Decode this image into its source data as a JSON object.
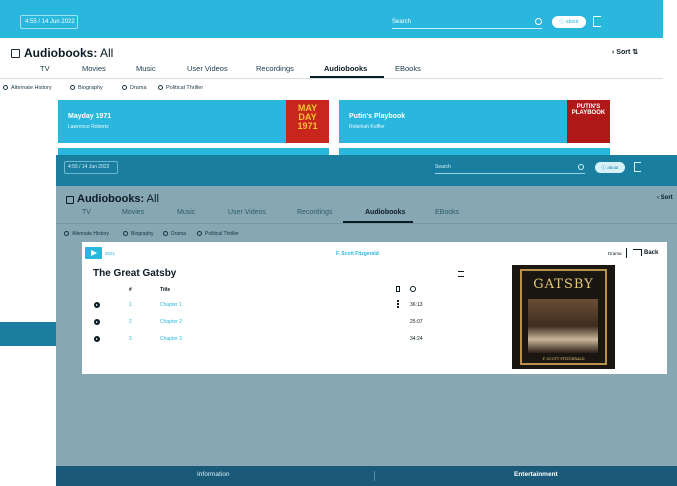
{
  "colors": {
    "accent": "#2ab7dd",
    "dark": "#0b1b24",
    "dim_bar": "#1a7ea0"
  },
  "background_screen": {
    "datetime": "4:55 / 14 Jun 2022",
    "search_label": "Search",
    "about_label": "ⓘ about",
    "title_prefix": "Audiobooks:",
    "title_suffix": "All",
    "sort_label": "‹  Sort ⇅",
    "tabs": [
      "TV",
      "Movies",
      "Music",
      "User Videos",
      "Recordings",
      "Audiobooks",
      "EBooks"
    ],
    "active_tab": "Audiobooks",
    "filters": [
      "Alternate History",
      "Biography",
      "Drama",
      "Political Thriller"
    ],
    "cards": [
      {
        "title": "Mayday 1971",
        "author": "Lawrence Roberts",
        "cover_text": "MAY DAY 1971",
        "cover_color": "#c8251d"
      },
      {
        "title": "Putin's Playbook",
        "author": "Rebekah Koffler",
        "cover_text": "PUTIN'S PLAYBOOK",
        "cover_color": "#b01818"
      }
    ]
  },
  "foreground_screen": {
    "datetime": "4:55 / 14 Jun 2022",
    "search_label": "Search",
    "about_label": "ⓘ about",
    "title_prefix": "Audiobooks:",
    "title_suffix": "All",
    "sort_label": "‹ Sort",
    "tabs": [
      "TV",
      "Movies",
      "Music",
      "User Videos",
      "Recordings",
      "Audiobooks",
      "EBooks"
    ],
    "active_tab": "Audiobooks",
    "filters": [
      "Alternate History",
      "Biography",
      "Drama",
      "Political Thriller"
    ],
    "detail": {
      "year": "2021",
      "author": "F. Scott Fitzgerald",
      "genre": "Drama",
      "back_label": "Back",
      "book_title": "The Great Gatsby",
      "columns": {
        "number": "#",
        "title": "Title"
      },
      "chapters": [
        {
          "n": "1",
          "title": "Chapter 1",
          "duration": "36:13"
        },
        {
          "n": "2",
          "title": "Chapter 2",
          "duration": "25:07"
        },
        {
          "n": "3",
          "title": "Chapter 3",
          "duration": "34:24"
        }
      ],
      "cover": {
        "title": "GATSBY",
        "subtitle": "F. SCOTT FITZGERALD"
      }
    },
    "footer": {
      "left": "Information",
      "right": "Entertainment"
    }
  },
  "icons": [
    "library-icon",
    "search-icon",
    "exit-icon",
    "play-icon",
    "back-icon",
    "queue-icon",
    "bookmark-icon",
    "clock-icon",
    "more-icon"
  ]
}
